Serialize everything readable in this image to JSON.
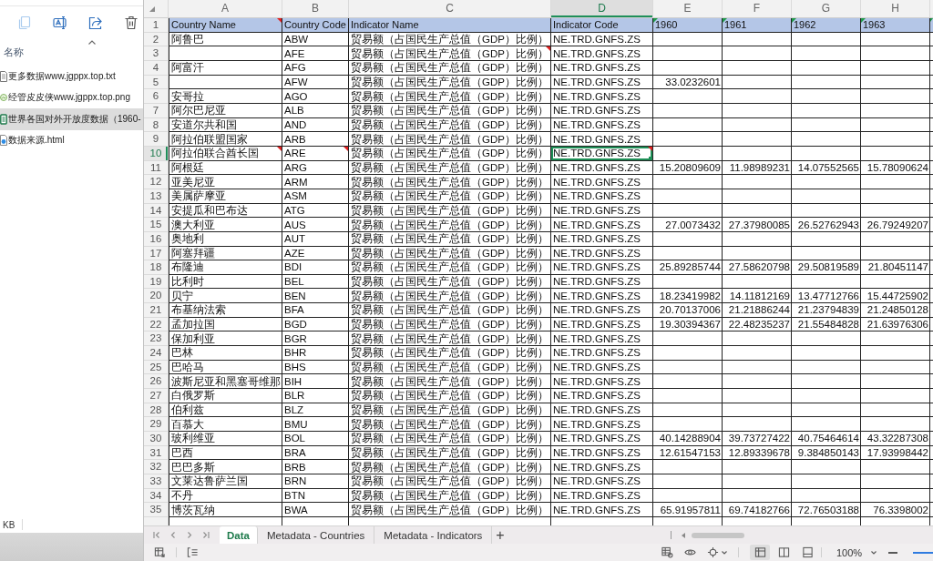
{
  "explorer": {
    "toolbar": [
      {
        "kind": "copy",
        "disabled": true
      },
      {
        "kind": "rename",
        "disabled": false
      },
      {
        "kind": "share",
        "disabled": false
      },
      {
        "kind": "delete",
        "disabled": false
      }
    ],
    "column_header": "名称",
    "files": [
      {
        "name": "更多数据www.jgppx.top.txt",
        "kind": "text",
        "selected": false
      },
      {
        "name": "经管皮皮侠www.jgppx.top.png",
        "kind": "image",
        "selected": false
      },
      {
        "name": "世界各国对外开放度数据（1960-",
        "kind": "spreadsheet",
        "selected": true
      },
      {
        "name": "数据来源.html",
        "kind": "web",
        "selected": false
      }
    ],
    "status": "KB"
  },
  "spreadsheet": {
    "columns": [
      {
        "letter": "A",
        "selected": false
      },
      {
        "letter": "B",
        "selected": false
      },
      {
        "letter": "C",
        "selected": false
      },
      {
        "letter": "D",
        "selected": true
      },
      {
        "letter": "E",
        "selected": false
      },
      {
        "letter": "F",
        "selected": false
      },
      {
        "letter": "G",
        "selected": false
      },
      {
        "letter": "H",
        "selected": false
      }
    ],
    "header_row": {
      "number": "1",
      "selected": false,
      "cells": [
        {
          "text": "Country Name",
          "commented": true,
          "flagged": false
        },
        {
          "text": "Country Code",
          "commented": false,
          "flagged": false
        },
        {
          "text": "Indicator Name",
          "commented": false,
          "flagged": false
        },
        {
          "text": "Indicator Code",
          "commented": false,
          "flagged": false
        },
        {
          "text": "1960",
          "commented": false,
          "flagged": true
        },
        {
          "text": "1961",
          "commented": false,
          "flagged": true
        },
        {
          "text": "1962",
          "commented": false,
          "flagged": true
        },
        {
          "text": "1963",
          "commented": false,
          "flagged": true
        },
        {
          "commented": false,
          "flagged": true
        }
      ]
    },
    "rows": [
      {
        "number": "2",
        "selected": false,
        "country_name": "阿鲁巴",
        "country_code": "ABW",
        "indicator_name": "贸易额（占国民生产总值（GDP）比例）",
        "indicator_code": "NE.TRD.GNFS.ZS"
      },
      {
        "number": "3",
        "selected": false,
        "country_code": "AFE",
        "indicator_name": "贸易额（占国民生产总值（GDP）比例）",
        "indicator_code": "NE.TRD.GNFS.ZS",
        "comments": [
          false,
          false,
          true,
          false
        ]
      },
      {
        "number": "4",
        "selected": false,
        "country_name": "阿富汗",
        "country_code": "AFG",
        "indicator_name": "贸易额（占国民生产总值（GDP）比例）",
        "indicator_code": "NE.TRD.GNFS.ZS"
      },
      {
        "number": "5",
        "selected": false,
        "country_code": "AFW",
        "indicator_name": "贸易额（占国民生产总值（GDP）比例）",
        "indicator_code": "NE.TRD.GNFS.ZS",
        "values": [
          "33.0232601"
        ]
      },
      {
        "number": "6",
        "selected": false,
        "country_name": "安哥拉",
        "country_code": "AGO",
        "indicator_name": "贸易额（占国民生产总值（GDP）比例）",
        "indicator_code": "NE.TRD.GNFS.ZS"
      },
      {
        "number": "7",
        "selected": false,
        "country_name": "阿尔巴尼亚",
        "country_code": "ALB",
        "indicator_name": "贸易额（占国民生产总值（GDP）比例）",
        "indicator_code": "NE.TRD.GNFS.ZS"
      },
      {
        "number": "8",
        "selected": false,
        "country_name": "安道尔共和国",
        "country_code": "AND",
        "indicator_name": "贸易额（占国民生产总值（GDP）比例）",
        "indicator_code": "NE.TRD.GNFS.ZS"
      },
      {
        "number": "9",
        "selected": false,
        "country_name": "阿拉伯联盟国家",
        "country_code": "ARB",
        "indicator_name": "贸易额（占国民生产总值（GDP）比例）",
        "indicator_code": "NE.TRD.GNFS.ZS"
      },
      {
        "number": "10",
        "selected": true,
        "country_name": "阿拉伯联合酋长国",
        "country_code": "ARE",
        "indicator_name": "贸易额（占国民生产总值（GDP）比例）",
        "indicator_code": "NE.TRD.GNFS.ZS",
        "comments": [
          true,
          true,
          false,
          true
        ]
      },
      {
        "number": "11",
        "selected": false,
        "country_name": "阿根廷",
        "country_code": "ARG",
        "indicator_name": "贸易额（占国民生产总值（GDP）比例）",
        "indicator_code": "NE.TRD.GNFS.ZS",
        "values": [
          "15.20809609",
          "11.98989231",
          "14.07552565",
          "15.78090624"
        ]
      },
      {
        "number": "12",
        "selected": false,
        "country_name": "亚美尼亚",
        "country_code": "ARM",
        "indicator_name": "贸易额（占国民生产总值（GDP）比例）",
        "indicator_code": "NE.TRD.GNFS.ZS"
      },
      {
        "number": "13",
        "selected": false,
        "country_name": "美属萨摩亚",
        "country_code": "ASM",
        "indicator_name": "贸易额（占国民生产总值（GDP）比例）",
        "indicator_code": "NE.TRD.GNFS.ZS"
      },
      {
        "number": "14",
        "selected": false,
        "country_name": "安提瓜和巴布达",
        "country_code": "ATG",
        "indicator_name": "贸易额（占国民生产总值（GDP）比例）",
        "indicator_code": "NE.TRD.GNFS.ZS"
      },
      {
        "number": "15",
        "selected": false,
        "country_name": "澳大利亚",
        "country_code": "AUS",
        "indicator_name": "贸易额（占国民生产总值（GDP）比例）",
        "indicator_code": "NE.TRD.GNFS.ZS",
        "values": [
          "27.0073432",
          "27.37980085",
          "26.52762943",
          "26.79249207"
        ]
      },
      {
        "number": "16",
        "selected": false,
        "country_name": "奥地利",
        "country_code": "AUT",
        "indicator_name": "贸易额（占国民生产总值（GDP）比例）",
        "indicator_code": "NE.TRD.GNFS.ZS"
      },
      {
        "number": "17",
        "selected": false,
        "country_name": "阿塞拜疆",
        "country_code": "AZE",
        "indicator_name": "贸易额（占国民生产总值（GDP）比例）",
        "indicator_code": "NE.TRD.GNFS.ZS"
      },
      {
        "number": "18",
        "selected": false,
        "country_name": "布隆迪",
        "country_code": "BDI",
        "indicator_name": "贸易额（占国民生产总值（GDP）比例）",
        "indicator_code": "NE.TRD.GNFS.ZS",
        "values": [
          "25.89285744",
          "27.58620798",
          "29.50819589",
          "21.80451147"
        ]
      },
      {
        "number": "19",
        "selected": false,
        "country_name": "比利时",
        "country_code": "BEL",
        "indicator_name": "贸易额（占国民生产总值（GDP）比例）",
        "indicator_code": "NE.TRD.GNFS.ZS"
      },
      {
        "number": "20",
        "selected": false,
        "country_name": "贝宁",
        "country_code": "BEN",
        "indicator_name": "贸易额（占国民生产总值（GDP）比例）",
        "indicator_code": "NE.TRD.GNFS.ZS",
        "values": [
          "18.23419982",
          "14.11812169",
          "13.47712766",
          "15.44725902"
        ]
      },
      {
        "number": "21",
        "selected": false,
        "country_name": "布基纳法索",
        "country_code": "BFA",
        "indicator_name": "贸易额（占国民生产总值（GDP）比例）",
        "indicator_code": "NE.TRD.GNFS.ZS",
        "values": [
          "20.70137006",
          "21.21886244",
          "21.23794839",
          "21.24850128"
        ]
      },
      {
        "number": "22",
        "selected": false,
        "country_name": "孟加拉国",
        "country_code": "BGD",
        "indicator_name": "贸易额（占国民生产总值（GDP）比例）",
        "indicator_code": "NE.TRD.GNFS.ZS",
        "values": [
          "19.30394367",
          "22.48235237",
          "21.55484828",
          "21.63976306"
        ]
      },
      {
        "number": "23",
        "selected": false,
        "country_name": "保加利亚",
        "country_code": "BGR",
        "indicator_name": "贸易额（占国民生产总值（GDP）比例）",
        "indicator_code": "NE.TRD.GNFS.ZS"
      },
      {
        "number": "24",
        "selected": false,
        "country_name": "巴林",
        "country_code": "BHR",
        "indicator_name": "贸易额（占国民生产总值（GDP）比例）",
        "indicator_code": "NE.TRD.GNFS.ZS"
      },
      {
        "number": "25",
        "selected": false,
        "country_name": "巴哈马",
        "country_code": "BHS",
        "indicator_name": "贸易额（占国民生产总值（GDP）比例）",
        "indicator_code": "NE.TRD.GNFS.ZS"
      },
      {
        "number": "26",
        "selected": false,
        "country_name": "波斯尼亚和黑塞哥维那",
        "country_code": "BIH",
        "indicator_name": "贸易额（占国民生产总值（GDP）比例）",
        "indicator_code": "NE.TRD.GNFS.ZS"
      },
      {
        "number": "27",
        "selected": false,
        "country_name": "白俄罗斯",
        "country_code": "BLR",
        "indicator_name": "贸易额（占国民生产总值（GDP）比例）",
        "indicator_code": "NE.TRD.GNFS.ZS"
      },
      {
        "number": "28",
        "selected": false,
        "country_name": "伯利兹",
        "country_code": "BLZ",
        "indicator_name": "贸易额（占国民生产总值（GDP）比例）",
        "indicator_code": "NE.TRD.GNFS.ZS"
      },
      {
        "number": "29",
        "selected": false,
        "country_name": "百慕大",
        "country_code": "BMU",
        "indicator_name": "贸易额（占国民生产总值（GDP）比例）",
        "indicator_code": "NE.TRD.GNFS.ZS"
      },
      {
        "number": "30",
        "selected": false,
        "country_name": "玻利维亚",
        "country_code": "BOL",
        "indicator_name": "贸易额（占国民生产总值（GDP）比例）",
        "indicator_code": "NE.TRD.GNFS.ZS",
        "values": [
          "40.14288904",
          "39.73727422",
          "40.75464614",
          "43.32287308"
        ]
      },
      {
        "number": "31",
        "selected": false,
        "country_name": "巴西",
        "country_code": "BRA",
        "indicator_name": "贸易额（占国民生产总值（GDP）比例）",
        "indicator_code": "NE.TRD.GNFS.ZS",
        "values": [
          "12.61547153",
          "12.89339678",
          "9.384850143",
          "17.93998442"
        ]
      },
      {
        "number": "32",
        "selected": false,
        "country_name": "巴巴多斯",
        "country_code": "BRB",
        "indicator_name": "贸易额（占国民生产总值（GDP）比例）",
        "indicator_code": "NE.TRD.GNFS.ZS"
      },
      {
        "number": "33",
        "selected": false,
        "country_name": "文莱达鲁萨兰国",
        "country_code": "BRN",
        "indicator_name": "贸易额（占国民生产总值（GDP）比例）",
        "indicator_code": "NE.TRD.GNFS.ZS"
      },
      {
        "number": "34",
        "selected": false,
        "country_name": "不丹",
        "country_code": "BTN",
        "indicator_name": "贸易额（占国民生产总值（GDP）比例）",
        "indicator_code": "NE.TRD.GNFS.ZS"
      },
      {
        "number": "35",
        "selected": false,
        "country_name": "博茨瓦纳",
        "country_code": "BWA",
        "indicator_name": "贸易额（占国民生产总值（GDP）比例）",
        "indicator_code": "NE.TRD.GNFS.ZS",
        "values": [
          "65.91957811",
          "69.74182766",
          "72.76503188",
          "76.3398002"
        ]
      }
    ],
    "sheet_tabs": [
      {
        "label": "Data",
        "selected": true
      },
      {
        "label": "Metadata - Countries",
        "selected": false
      },
      {
        "label": "Metadata - Indicators",
        "selected": false
      }
    ],
    "add_sheet": "+",
    "status_bar": {
      "views": [
        {
          "kind": "normal",
          "selected": true
        },
        {
          "kind": "page_break",
          "selected": false
        },
        {
          "kind": "page_layout",
          "selected": false
        }
      ],
      "zoom": "100%"
    }
  }
}
